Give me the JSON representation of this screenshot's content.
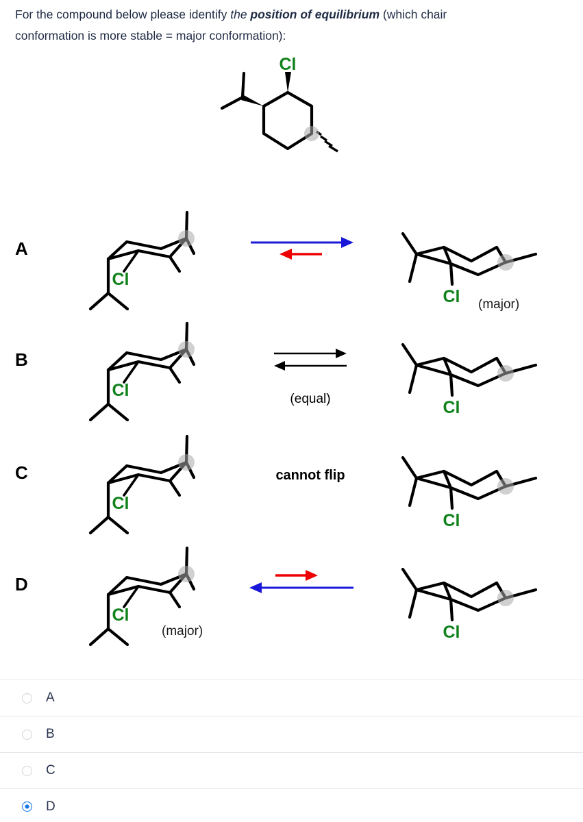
{
  "prompt": {
    "part1": "For the compound below please identify ",
    "part2_italic": "the ",
    "part3_italic_bold": "position of equilibrium",
    "part4": " (which chair",
    "line2": "conformation is more stable = major conformation):"
  },
  "top_compound": {
    "substituent_label": "Cl",
    "description": "cyclohexane with isopropyl wedge, Cl wedge, methyl hash"
  },
  "colors": {
    "chlorine_green": "#11821b",
    "arrow_blue": "#1a18d8",
    "arrow_red": "#ee0000",
    "arrow_black": "#000000",
    "radio_selected_blue": "#1a78e8",
    "text_dark": "#1f2b44",
    "atom_marker_gray": "#aaaaaa"
  },
  "rows": [
    {
      "label": "A",
      "left_cl_label": "Cl",
      "left_major_label": "",
      "right_cl_label": "Cl",
      "right_major_label": "(major)",
      "arrow_type": "forward-favored",
      "arrow_top_color": "#1a18d8",
      "arrow_top_direction": "right",
      "arrow_top_length": "long",
      "arrow_bottom_color": "#ee0000",
      "arrow_bottom_direction": "left",
      "arrow_bottom_length": "short",
      "center_text": ""
    },
    {
      "label": "B",
      "left_cl_label": "Cl",
      "left_major_label": "",
      "right_cl_label": "Cl",
      "right_major_label": "",
      "arrow_type": "equal",
      "arrow_top_color": "#000000",
      "arrow_top_direction": "right",
      "arrow_top_length": "equal",
      "arrow_bottom_color": "#000000",
      "arrow_bottom_direction": "left",
      "arrow_bottom_length": "equal",
      "center_text": "(equal)"
    },
    {
      "label": "C",
      "left_cl_label": "Cl",
      "left_major_label": "",
      "right_cl_label": "Cl",
      "right_major_label": "",
      "arrow_type": "none",
      "arrow_top_color": "",
      "arrow_top_direction": "",
      "arrow_top_length": "",
      "arrow_bottom_color": "",
      "arrow_bottom_direction": "",
      "arrow_bottom_length": "",
      "center_text": "cannot flip"
    },
    {
      "label": "D",
      "left_cl_label": "Cl",
      "left_major_label": "(major)",
      "right_cl_label": "Cl",
      "right_major_label": "",
      "arrow_type": "reverse-favored",
      "arrow_top_color": "#ee0000",
      "arrow_top_direction": "right",
      "arrow_top_length": "short",
      "arrow_bottom_color": "#1a18d8",
      "arrow_bottom_direction": "left",
      "arrow_bottom_length": "long",
      "center_text": ""
    }
  ],
  "options": [
    {
      "label": "A",
      "selected": false
    },
    {
      "label": "B",
      "selected": false
    },
    {
      "label": "C",
      "selected": false
    },
    {
      "label": "D",
      "selected": true
    }
  ]
}
